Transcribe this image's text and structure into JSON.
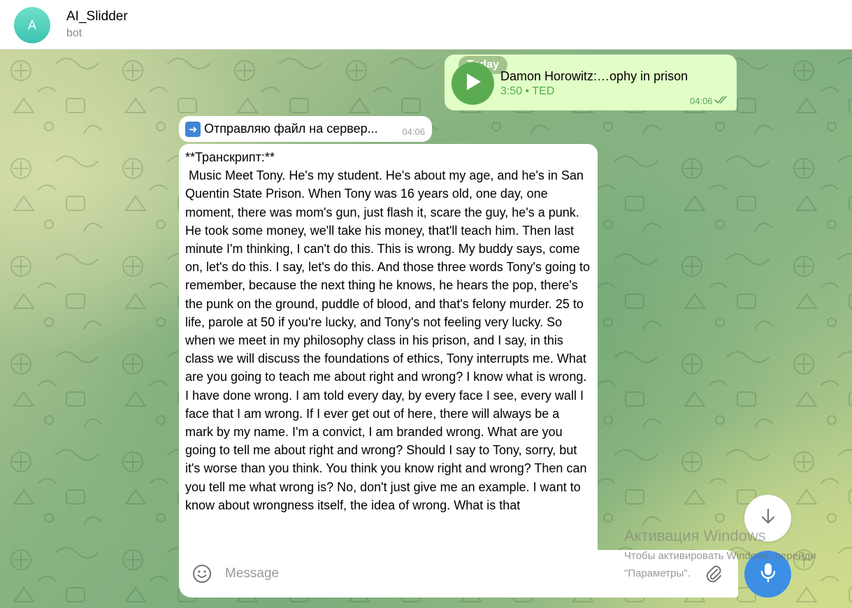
{
  "header": {
    "avatar_letter": "A",
    "title": "AI_Slidder",
    "subtitle": "bot"
  },
  "colors": {
    "outgoing_bubble": "#e1fec6",
    "incoming_bubble": "#ffffff",
    "accent_green": "#5bab51",
    "mic_blue": "#3d8fe6",
    "avatar_teal": "#3cc3b0"
  },
  "date_divider": "Today",
  "messages": {
    "media": {
      "title": "Damon Horowitz:…ophy in prison",
      "subtitle": "3:50 • TED",
      "time": "04:06",
      "play_icon": "play-icon",
      "status_icon": "double-check-icon"
    },
    "status": {
      "emoji": "➡️",
      "text": "Отправляю файл на сервер...",
      "time": "04:06"
    },
    "transcript": {
      "text": "**Транскрипт:**\n Music Meet Tony. He's my student. He's about my age, and he's in San Quentin State Prison. When Tony was 16 years old, one day, one moment, there was mom's gun, just flash it, scare the guy, he's a punk. He took some money, we'll take his money, that'll teach him. Then last minute I'm thinking, I can't do this. This is wrong. My buddy says, come on, let's do this. I say, let's do this. And those three words Tony's going to remember, because the next thing he knows, he hears the pop, there's the punk on the ground, puddle of blood, and that's felony murder. 25 to life, parole at 50 if you're lucky, and Tony's not feeling very lucky. So when we meet in my philosophy class in his prison, and I say, in this class we will discuss the foundations of ethics, Tony interrupts me. What are you going to teach me about right and wrong? I know what is wrong. I have done wrong. I am told every day, by every face I see, every wall I face that I am wrong. If I ever get out of here, there will always be a mark by my name. I'm a convict, I am branded wrong. What are you going to tell me about right and wrong? Should I say to Tony, sorry, but it's worse than you think. You think you know right and wrong? Then can you tell me what wrong is? No, don't just give me an example. I want to know about wrongness itself, the idea of wrong. What is that"
    }
  },
  "composer": {
    "placeholder": "Message",
    "emoji_icon": "smile-icon",
    "attach_icon": "paperclip-icon",
    "mic_icon": "microphone-icon",
    "scroll_icon": "arrow-down-icon"
  },
  "watermark": {
    "line1": "Активация Windows",
    "line2": "Чтобы активировать Windows, перейди",
    "line3": "\"Параметры\"."
  }
}
